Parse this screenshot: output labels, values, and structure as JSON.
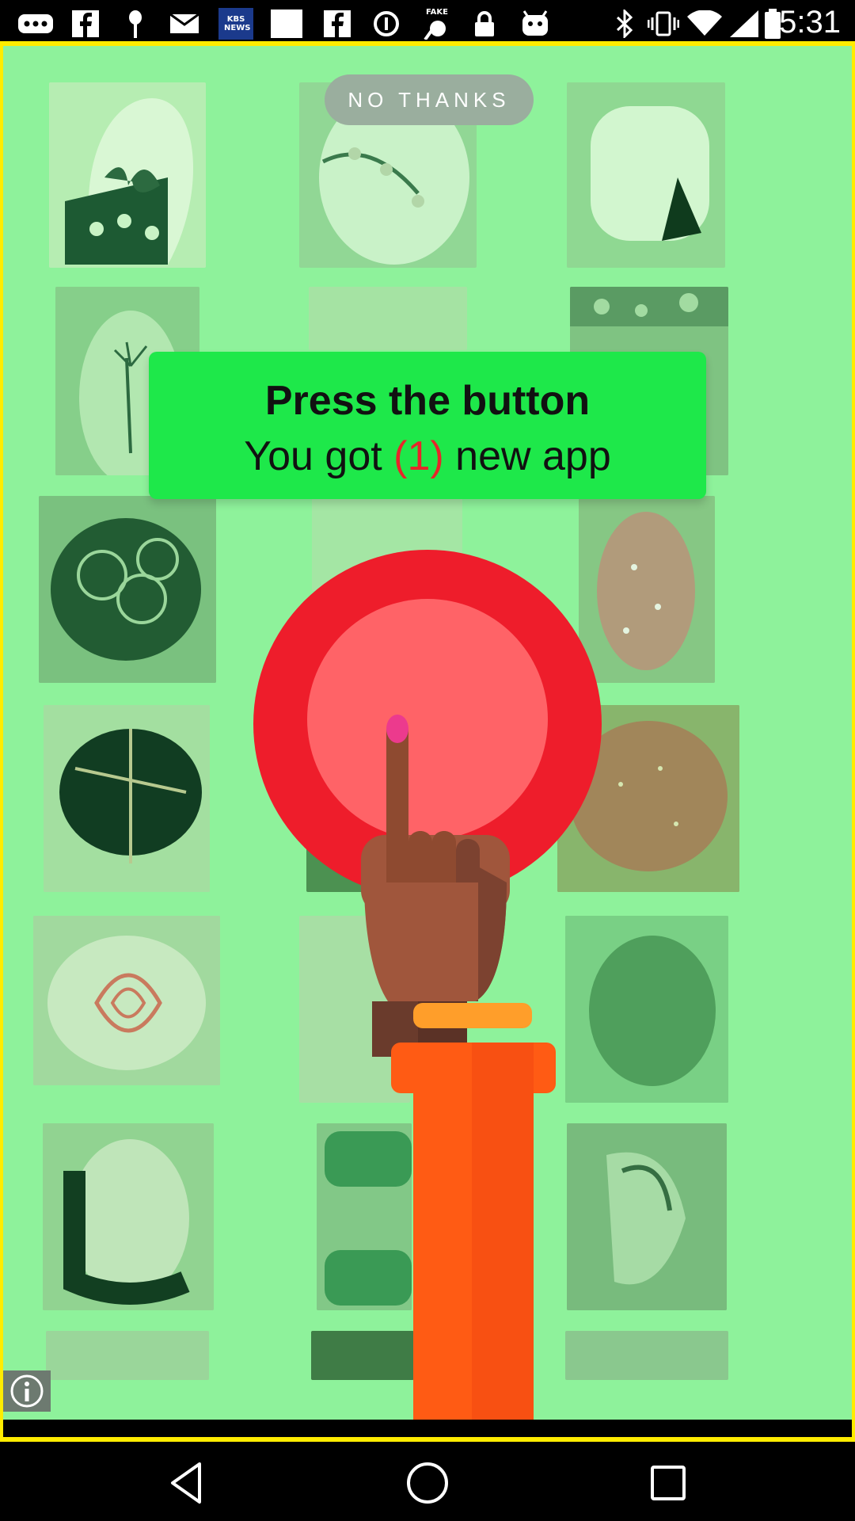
{
  "status_bar": {
    "time": "5:31",
    "left_icons": [
      "more-icon",
      "facebook-icon",
      "pin-icon",
      "mail-icon",
      "kbs-news-icon",
      "blank-icon",
      "facebook-icon",
      "circle-info-icon",
      "fake-gps-icon",
      "lock-icon",
      "android-icon"
    ],
    "kbs_label": "KBS NEWS",
    "fake_label": "FAKE",
    "right_icons": [
      "bluetooth-icon",
      "vibrate-icon",
      "wifi-icon",
      "signal-icon",
      "battery-icon"
    ]
  },
  "ad": {
    "no_thanks_label": "NO THANKS",
    "headline": "Press the button",
    "subline_prefix": "You got ",
    "subline_count": "(1)",
    "subline_suffix": " new app",
    "colors": {
      "overlay_green": "#8ef29b",
      "banner_green": "#1ee84a",
      "button_outer": "#ee1d2b",
      "button_inner": "#ff6367",
      "sleeve": "#ff5b14",
      "cuff": "#ff9e2a",
      "frame_yellow": "#ffec00"
    },
    "info_icon": "info-icon"
  },
  "nav_bar": {
    "back": "back-icon",
    "home": "home-icon",
    "recents": "recents-icon"
  }
}
